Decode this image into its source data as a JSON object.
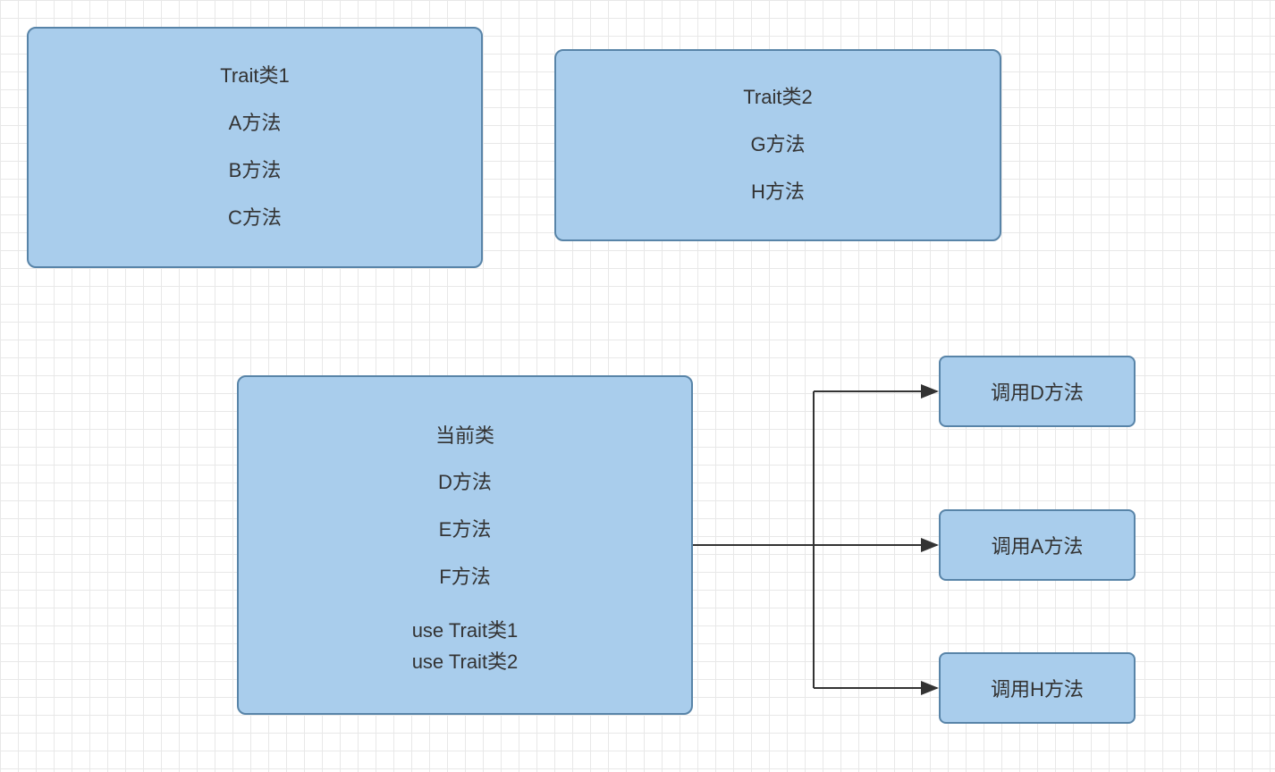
{
  "colors": {
    "boxFill": "#a9cdec",
    "boxBorder": "#5884a8",
    "arrow": "#333333",
    "grid": "#e8e8e8"
  },
  "trait1": {
    "title": "Trait类1",
    "methodA": "A方法",
    "methodB": "B方法",
    "methodC": "C方法"
  },
  "trait2": {
    "title": "Trait类2",
    "methodG": "G方法",
    "methodH": "H方法"
  },
  "currentClass": {
    "title": "当前类",
    "methodD": "D方法",
    "methodE": "E方法",
    "methodF": "F方法",
    "use1": "use Trait类1",
    "use2": "use Trait类2"
  },
  "calls": {
    "callD": "调用D方法",
    "callA": "调用A方法",
    "callH": "调用H方法"
  }
}
